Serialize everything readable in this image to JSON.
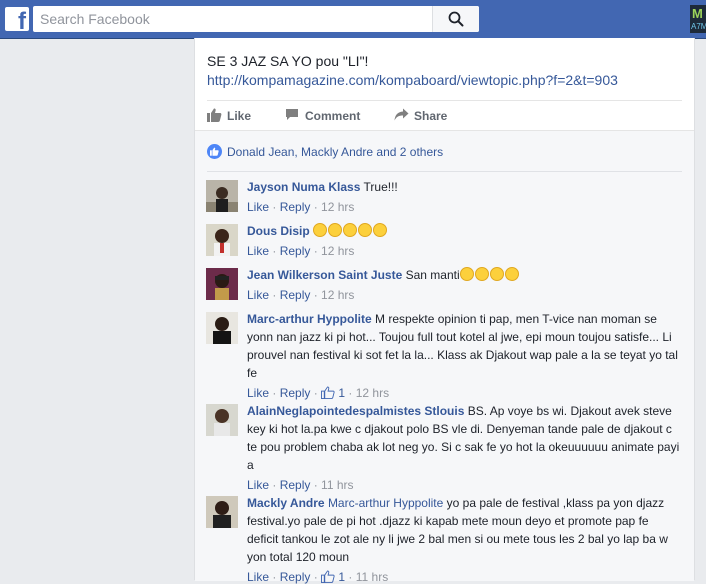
{
  "topbar": {
    "search_placeholder": "Search Facebook",
    "logo_letter": "f",
    "badge_line1": "M",
    "badge_line2": "A7M"
  },
  "post": {
    "text": "SE 3 JAZ SA YO pou \"LI\"!",
    "link": "http://kompamagazine.com/kompaboard/viewtopic.php?f=2&t=903",
    "actions": {
      "like": "Like",
      "comment": "Comment",
      "share": "Share"
    }
  },
  "reactions": {
    "text": "Donald Jean, Mackly Andre and 2 others"
  },
  "comments": [
    {
      "author": "Jayson Numa Klass",
      "text": "True!!!",
      "like": "Like",
      "reply": "Reply",
      "time": "12 hrs"
    },
    {
      "author": "Dous Disip",
      "emoji": "😂😂😂😂😂",
      "text": "",
      "like": "Like",
      "reply": "Reply",
      "time": "12 hrs"
    },
    {
      "author": "Jean Wilkerson Saint Juste",
      "text": "San manti",
      "emoji": "😂😂😂😂",
      "like": "Like",
      "reply": "Reply",
      "time": "12 hrs"
    },
    {
      "author": "Marc-arthur Hyppolite",
      "text": "M respekte opinion ti pap, men T-vice nan moman se yonn nan jazz ki pi hot... Toujou full tout kotel al jwe, epi moun toujou satisfe... Li prouvel nan festival ki sot fet la la... Klass ak Djakout wap pale a la se teyat yo tal fe",
      "like": "Like",
      "reply": "Reply",
      "likes_count": "1",
      "time": "12 hrs"
    },
    {
      "author": "AlainNeglapointedespalmistes Stlouis",
      "text": "BS. Ap voye bs wi. Djakout avek steve key ki hot la.pa kwe c djakout polo BS vle di. Denyeman tande pale de djakout c te pou problem chaba ak lot neg yo. Si c sak fe yo hot la okeuuuuuu animate payi a",
      "like": "Like",
      "reply": "Reply",
      "time": "11 hrs"
    },
    {
      "author": "Mackly Andre",
      "mention": "Marc-arthur Hyppolite",
      "text": "yo pa pale de festival ,klass pa yon djazz festival.yo pale de pi hot .djazz ki kapab mete moun deyo et promote pap fe deficit tankou le zot ale ny li jwe 2 bal men si ou mete tous les 2 bal yo lap ba w yon total 120 moun",
      "like": "Like",
      "reply": "Reply",
      "likes_count": "1",
      "time": "11 hrs"
    }
  ],
  "colors": {
    "brand": "#4267b2",
    "link": "#365899",
    "meta": "#90949c"
  }
}
